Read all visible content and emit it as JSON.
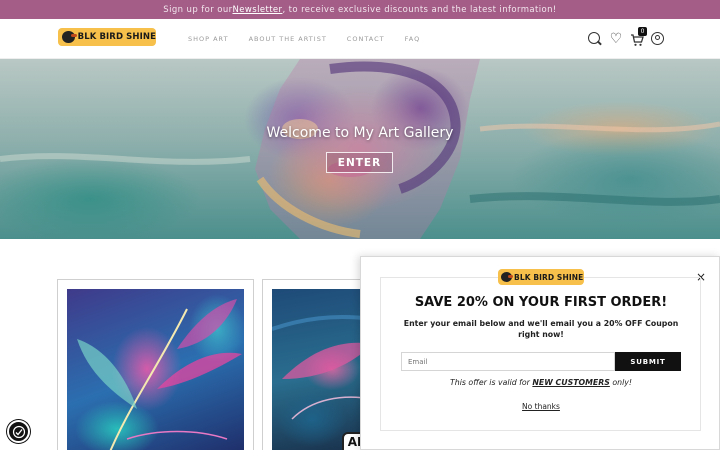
{
  "announcement": {
    "prefix": "Sign up for our ",
    "link": "Newsletter",
    "suffix": ", to receive exclusive discounts and the latest information!"
  },
  "header": {
    "logo_text": "BLK BIRD SHINE",
    "nav": [
      "SHOP ART",
      "ABOUT THE ARTIST",
      "CONTACT",
      "FAQ"
    ],
    "cart_count": "0",
    "icons": [
      "search-icon",
      "heart-icon",
      "cart-icon",
      "user-icon"
    ]
  },
  "hero": {
    "title": "Welcome to My Art Gallery",
    "button": "ENTER"
  },
  "products": {
    "badge_text": "AR"
  },
  "popup": {
    "logo_text": "BLK BIRD SHINE",
    "close": "×",
    "heading": "SAVE 20% ON YOUR FIRST ORDER!",
    "subtext": "Enter your email below and we'll email you a 20% OFF Coupon right now!",
    "email_placeholder": "Email",
    "submit_label": "SUBMIT",
    "offer_prefix": "This offer is valid for ",
    "offer_highlight": "NEW CUSTOMERS",
    "offer_suffix": " only!",
    "no_thanks": "No thanks"
  },
  "colors": {
    "announcement_bg": "#a35d87",
    "logo_bg": "#f6c04a",
    "button_dark": "#111111"
  }
}
